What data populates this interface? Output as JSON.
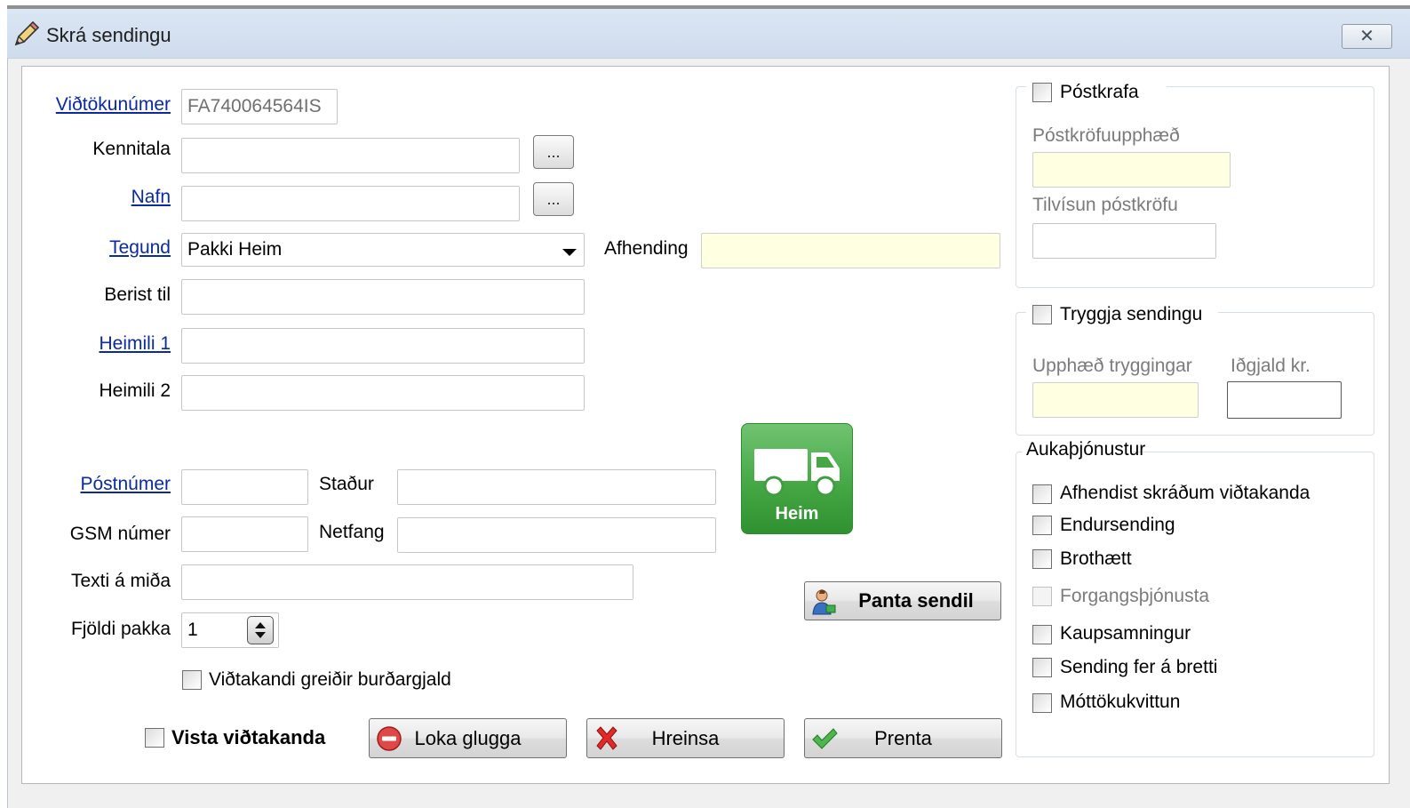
{
  "window": {
    "title": "Skrá sendingu",
    "close_glyph": "✕"
  },
  "form": {
    "vidtokunumer_label": "Viðtökunúmer",
    "vidtokunumer_value": "FA740064564IS",
    "kennitala_label": "Kennitala",
    "kennitala_value": "",
    "nafn_label": "Nafn",
    "nafn_value": "",
    "lookup_button": "...",
    "tegund_label": "Tegund",
    "tegund_value": "Pakki Heim",
    "afhending_label": "Afhending",
    "afhending_value": "",
    "berist_til_label": "Berist til",
    "berist_til_value": "",
    "heimili1_label": "Heimili 1",
    "heimili1_value": "",
    "heimili2_label": "Heimili 2",
    "heimili2_value": "",
    "postnumer_label": "Póstnúmer",
    "postnumer_value": "",
    "stadur_label": "Staður",
    "stadur_value": "",
    "gsm_label": "GSM númer",
    "gsm_value": "",
    "netfang_label": "Netfang",
    "netfang_value": "",
    "texti_label": "Texti á miða",
    "texti_value": "",
    "fjoldi_label": "Fjöldi pakka",
    "fjoldi_value": "1",
    "burdargjald_label": "Viðtakandi greiðir burðargjald",
    "burdargjald_checked": false
  },
  "delivery_tile": {
    "label": "Heim",
    "color": "#45a845"
  },
  "buttons": {
    "panta_sendil": "Panta sendil",
    "vista_label": "Vista viðtakanda",
    "vista_checked": false,
    "loka": "Loka glugga",
    "hreinsa": "Hreinsa",
    "prenta": "Prenta"
  },
  "postkrafa": {
    "title": "Póstkrafa",
    "checked": false,
    "upphaed_label": "Póstkröfuupphæð",
    "upphaed_value": "",
    "tilvisun_label": "Tilvísun póstkröfu",
    "tilvisun_value": ""
  },
  "trygging": {
    "title": "Tryggja sendingu",
    "checked": false,
    "upphaed_label": "Upphæð tryggingar",
    "upphaed_value": "",
    "idgjald_label": "Iðgjald kr.",
    "idgjald_value": ""
  },
  "aukathjonustur": {
    "title": "Aukaþjónustur",
    "items": [
      {
        "label": "Afhendist skráðum viðtakanda",
        "checked": false,
        "enabled": true
      },
      {
        "label": "Endursending",
        "checked": false,
        "enabled": true
      },
      {
        "label": "Brothætt",
        "checked": false,
        "enabled": true
      },
      {
        "label": "Forgangsþjónusta",
        "checked": false,
        "enabled": false
      },
      {
        "label": "Kaupsamningur",
        "checked": false,
        "enabled": true
      },
      {
        "label": "Sending fer á bretti",
        "checked": false,
        "enabled": true
      },
      {
        "label": "Móttökukvittun",
        "checked": false,
        "enabled": true
      }
    ]
  }
}
